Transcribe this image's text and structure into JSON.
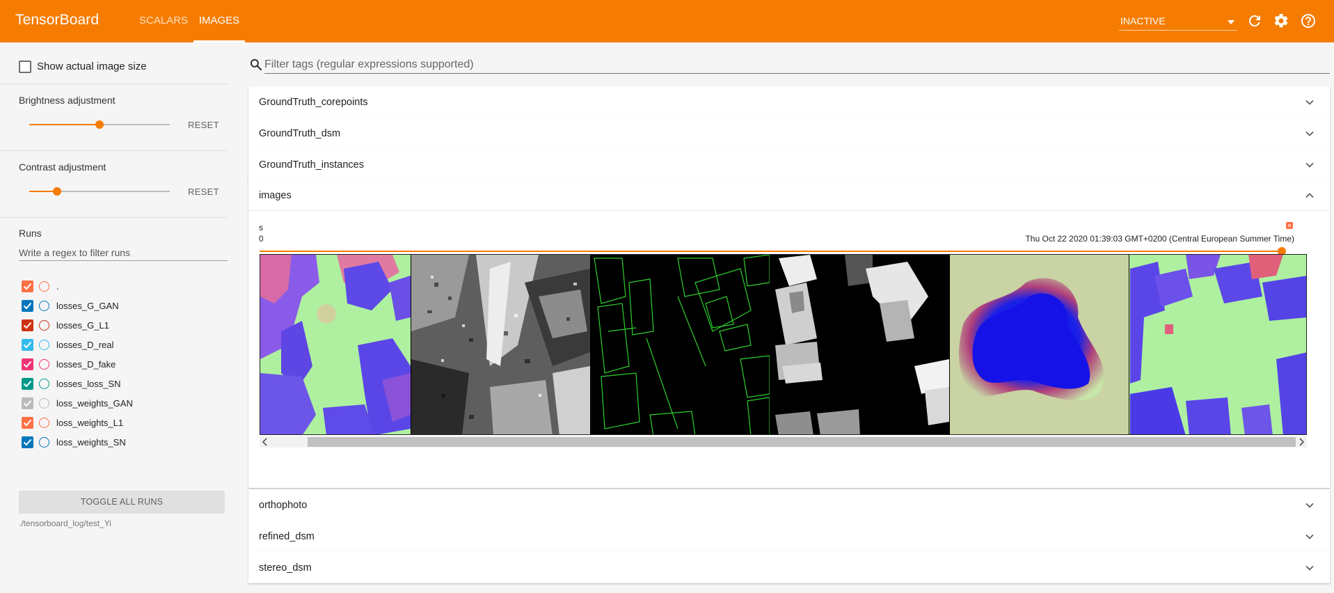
{
  "topbar": {
    "brand": "TensorBoard",
    "tabs": [
      {
        "label": "SCALARS"
      },
      {
        "label": "IMAGES"
      }
    ],
    "active_tab": "IMAGES",
    "status": "INACTIVE",
    "icons": [
      "refresh-icon",
      "settings-icon",
      "help-icon"
    ],
    "color": "#f57c00"
  },
  "sidebar": {
    "show_actual_size_label": "Show actual image size",
    "show_actual_size_checked": false,
    "brightness": {
      "label": "Brightness adjustment",
      "value": 0.5,
      "reset": "RESET"
    },
    "contrast": {
      "label": "Contrast adjustment",
      "value": 0.2,
      "reset": "RESET"
    },
    "runs": {
      "title": "Runs",
      "filter_placeholder": "Write a regex to filter runs",
      "items": [
        {
          "name": ".",
          "color": "#ff7043",
          "checked": true
        },
        {
          "name": "losses_G_GAN",
          "color": "#0077bb",
          "checked": true
        },
        {
          "name": "losses_G_L1",
          "color": "#cc3311",
          "checked": true
        },
        {
          "name": "losses_D_real",
          "color": "#33bbee",
          "checked": true
        },
        {
          "name": "losses_D_fake",
          "color": "#ee3377",
          "checked": true
        },
        {
          "name": "losses_loss_SN",
          "color": "#009988",
          "checked": true
        },
        {
          "name": "loss_weights_GAN",
          "color": "#bbbbbb",
          "checked": true
        },
        {
          "name": "loss_weights_L1",
          "color": "#ff7043",
          "checked": true
        },
        {
          "name": "loss_weights_SN",
          "color": "#0077bb",
          "checked": true
        }
      ],
      "toggle_all": "TOGGLE ALL RUNS",
      "logdir": "./tensorboard_log/test_Yi"
    }
  },
  "main": {
    "filter_placeholder": "Filter tags (regular expressions supported)",
    "categories_before": [
      {
        "name": "GroundTruth_corepoints"
      },
      {
        "name": "GroundTruth_dsm"
      },
      {
        "name": "GroundTruth_instances"
      }
    ],
    "expanded": {
      "name": "images",
      "card": {
        "tag_clipped": "s",
        "step_clipped": "0",
        "timestamp": "Thu Oct 22 2020 01:39:03 GMT+0200 (Central European Summer Time)",
        "run_color": "#ff7043",
        "step_slider_value": 1.0
      }
    },
    "categories_after": [
      {
        "name": "orthophoto"
      },
      {
        "name": "refined_dsm"
      },
      {
        "name": "stereo_dsm"
      }
    ]
  }
}
